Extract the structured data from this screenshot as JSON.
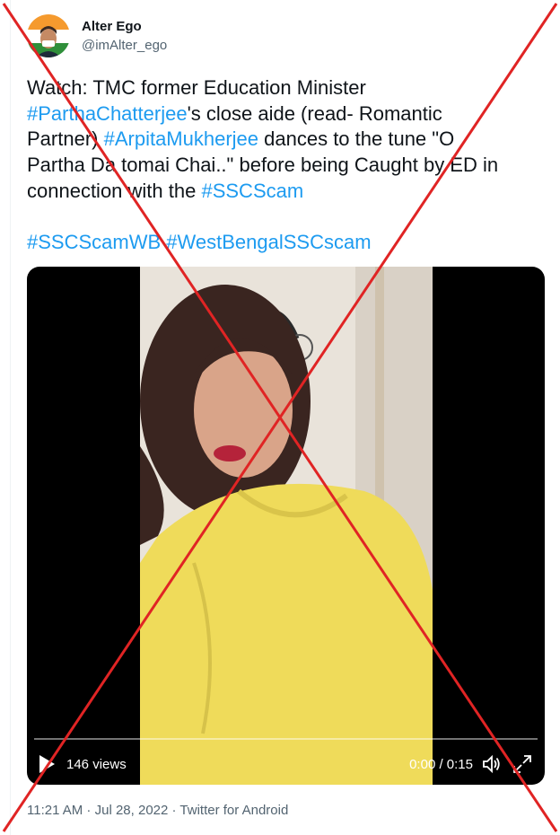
{
  "author": {
    "name": "Alter Ego",
    "handle": "@imAlter_ego"
  },
  "tweet": {
    "lines": [
      [
        {
          "text": "Watch: TMC former Education Minister",
          "tag": false
        }
      ],
      [
        {
          "text": "#ParthaChatterjee",
          "tag": true
        },
        {
          "text": "'s close aide (read- Romantic",
          "tag": false
        }
      ],
      [
        {
          "text": "Partner) ",
          "tag": false
        },
        {
          "text": "#ArpitaMukherjee",
          "tag": true
        },
        {
          "text": " dances to the tune \"O",
          "tag": false
        }
      ],
      [
        {
          "text": "Partha Da tomai Chai..\" before being Caught by ED in",
          "tag": false
        }
      ],
      [
        {
          "text": "connection with the ",
          "tag": false
        },
        {
          "text": "#SSCScam",
          "tag": true
        }
      ],
      [],
      [
        {
          "text": "#SSCScamWB",
          "tag": true
        },
        {
          "text": " ",
          "tag": false
        },
        {
          "text": "#WestBengalSSCscam",
          "tag": true
        }
      ]
    ]
  },
  "video": {
    "views": "146 views",
    "time": "0:00 / 0:15"
  },
  "meta": {
    "time": "11:21 AM",
    "sep1": " · ",
    "date": "Jul 28, 2022",
    "sep2": " · ",
    "client": "Twitter for Android"
  },
  "colors": {
    "link": "#1d9bf0",
    "text": "#0f1419",
    "secondary": "#536471",
    "cross": "#e02424",
    "shirt": "#efdb5a"
  },
  "icons": [
    "avatar-flag",
    "play-icon",
    "volume-icon",
    "fullscreen-icon"
  ]
}
